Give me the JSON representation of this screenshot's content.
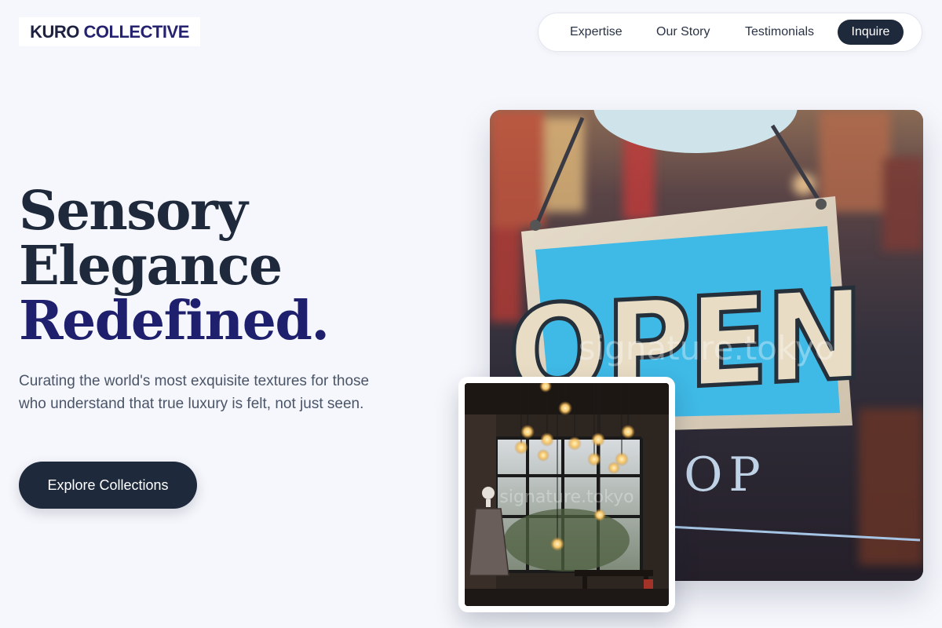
{
  "brand": {
    "name_part1": "KURO",
    "name_part2": "COLLECTIVE"
  },
  "nav": {
    "items": [
      {
        "label": "Expertise"
      },
      {
        "label": "Our Story"
      },
      {
        "label": "Testimonials"
      }
    ],
    "cta_label": "Inquire"
  },
  "hero": {
    "title_line1": "Sensory",
    "title_line2": "Elegance",
    "title_line3": "Redefined.",
    "subtitle": "Curating the world's most exquisite textures for those who understand that true luxury is felt, not just seen.",
    "cta_label": "Explore Collections"
  },
  "images": {
    "main": {
      "sign_text": "OPEN",
      "window_text": "OP",
      "watermark": "signature.tokyo"
    },
    "inset": {
      "watermark": "signature.tokyo"
    }
  },
  "colors": {
    "background": "#f6f7fc",
    "primary_dark": "#1e293b",
    "accent_navy": "#1e1f6d",
    "sign_blue": "#3fb9e6"
  }
}
